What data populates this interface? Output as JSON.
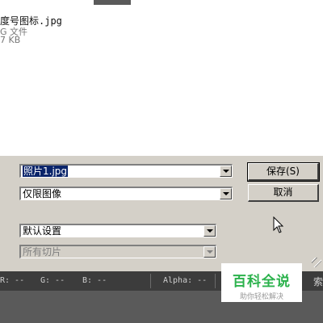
{
  "file_item": {
    "thumb_caption": "",
    "name": "度号图标.jpg",
    "type": "G 文件",
    "size": "7 KB"
  },
  "form": {
    "filename_value": "照片1.jpg",
    "format_value": "仅限图像",
    "settings_value": "默认设置",
    "slices_value": "所有切片"
  },
  "buttons": {
    "save": "保存(S)",
    "cancel": "取消"
  },
  "status": {
    "r": "R: --",
    "g": "G: --",
    "b": "B: --",
    "alpha": "Alpha: --",
    "right": "索"
  },
  "watermark": {
    "title": "百科全说",
    "subtitle": "助你轻松解决"
  }
}
